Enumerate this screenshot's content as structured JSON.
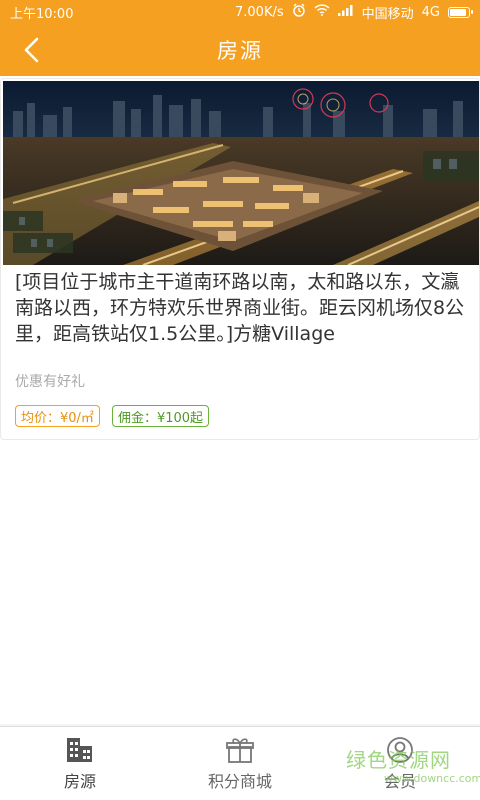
{
  "status_bar": {
    "time": "上午10:00",
    "net_speed": "7.00K/s",
    "carrier": "中国移动",
    "network": "4G"
  },
  "app_bar": {
    "title": "房源",
    "back_icon": "chevron-left-icon"
  },
  "listing": {
    "description": "[项目位于城市主干道南环路以南，太和路以东，文瀛南路以西，环方特欢乐世界商业街。距云冈机场仅8公里，距高铁站仅1.5公里。]方糖Village",
    "subtitle": "优惠有好礼",
    "price_tag": "均价：¥0/㎡",
    "commission_tag": "佣金：¥100起"
  },
  "bottom_nav": {
    "items": [
      {
        "label": "房源",
        "icon": "building-icon"
      },
      {
        "label": "积分商城",
        "icon": "gift-icon"
      },
      {
        "label": "会员",
        "icon": "user-icon"
      }
    ]
  },
  "watermark": {
    "line1": "绿色资源网",
    "line2": "www.downcc.com"
  },
  "colors": {
    "brand": "#f5a020",
    "tag_orange": "#f5a020",
    "tag_green": "#6cb13a"
  }
}
